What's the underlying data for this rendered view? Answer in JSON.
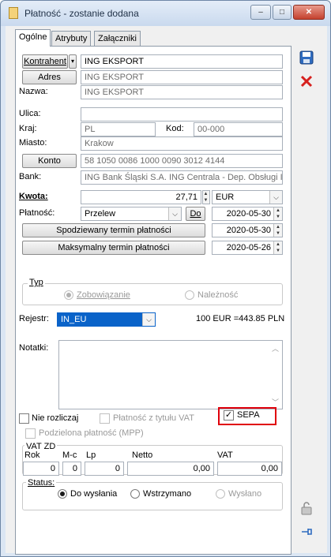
{
  "window": {
    "title": "Płatność - zostanie dodana",
    "minimize": "–",
    "maximize": "□",
    "close": "✕"
  },
  "tabs": [
    "Ogólne",
    "Atrybuty",
    "Załączniki"
  ],
  "form": {
    "kontrahent_btn": "Kontrahent",
    "kontrahent_value": "ING EKSPORT",
    "adres_btn": "Adres",
    "adres_value": "ING EKSPORT",
    "nazwa_label": "Nazwa:",
    "nazwa_value": "ING EKSPORT",
    "ulica_label": "Ulica:",
    "ulica_value": "",
    "kraj_label": "Kraj:",
    "kraj_value": "PL",
    "kod_label": "Kod:",
    "kod_value": "00-000",
    "miasto_label": "Miasto:",
    "miasto_value": "Krakow",
    "konto_btn": "Konto",
    "konto_value": "58 1050 0086 1000 0090 3012 4144",
    "bank_label": "Bank:",
    "bank_value": "ING Bank Śląski S.A. ING  Centrala - Dep. Obsługi I",
    "kwota_label": "Kwota:",
    "kwota_value": "27,71",
    "waluta_value": "EUR",
    "platnosc_label": "Płatność:",
    "platnosc_value": "Przelew",
    "do_btn": "Do",
    "do_date": "2020-05-30",
    "spodziewany_btn": "Spodziewany termin płatności",
    "spodziewany_date": "2020-05-30",
    "maksymalny_btn": "Maksymalny termin płatności",
    "maksymalny_date": "2020-05-26"
  },
  "typ": {
    "title": "Typ",
    "option1": "Zobowiązanie",
    "option2": "Należność"
  },
  "rejestr": {
    "label": "Rejestr:",
    "value": "IN_EU",
    "rate": "100 EUR =443.85 PLN"
  },
  "notatki": {
    "label": "Notatki:",
    "value": ""
  },
  "checks": {
    "nie_rozliczaj": "Nie rozliczaj",
    "platnosc_vat": "Płatność z tytułu VAT",
    "sepa": "SEPA",
    "podzielona": "Podzielona płatność (MPP)"
  },
  "vatzd": {
    "title": "VAT ZD",
    "rok_label": "Rok",
    "mc_label": "M-c",
    "lp_label": "Lp",
    "netto_label": "Netto",
    "vat_label": "VAT",
    "rok_value": "0",
    "mc_value": "0",
    "lp_value": "0",
    "netto_value": "0,00",
    "vat_value": "0,00"
  },
  "status": {
    "title": "Status:",
    "option1": "Do wysłania",
    "option2": "Wstrzymano",
    "option3": "Wysłano"
  },
  "colors": {
    "accent": "#0a63c9",
    "highlight": "#e0000b"
  }
}
